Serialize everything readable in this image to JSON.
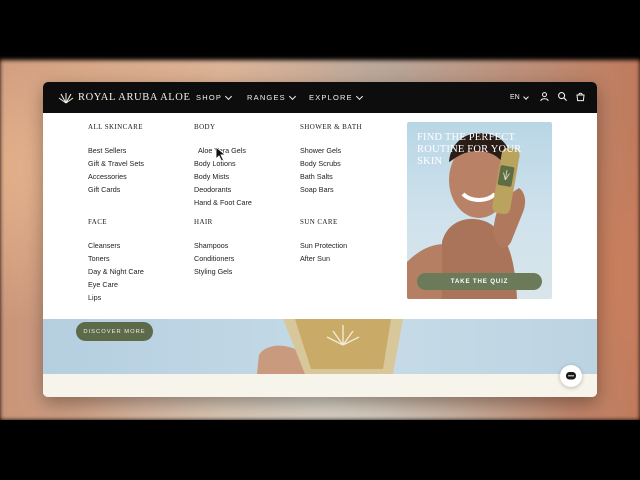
{
  "header": {
    "brand": "ROYAL ARUBA ALOE",
    "nav": [
      {
        "label": "SHOP"
      },
      {
        "label": "RANGES"
      },
      {
        "label": "EXPLORE"
      }
    ],
    "language": "EN"
  },
  "menu": {
    "columns": [
      {
        "heading": "ALL SKINCARE",
        "links": [
          "Best Sellers",
          "Gift & Travel Sets",
          "Accessories",
          "Gift Cards"
        ]
      },
      {
        "heading": "BODY",
        "links": [
          "Aloe Vera Gels",
          "Body Lotions",
          "Body Mists",
          "Deodorants",
          "Hand & Foot Care"
        ]
      },
      {
        "heading": "SHOWER & BATH",
        "links": [
          "Shower Gels",
          "Body Scrubs",
          "Bath Salts",
          "Soap Bars"
        ]
      },
      {
        "heading": "FACE",
        "links": [
          "Cleansers",
          "Toners",
          "Day & Night Care",
          "Eye Care",
          "Lips"
        ]
      },
      {
        "heading": "HAIR",
        "links": [
          "Shampoos",
          "Conditioners",
          "Styling Gels"
        ]
      },
      {
        "heading": "SUN CARE",
        "links": [
          "Sun Protection",
          "After Sun"
        ]
      }
    ]
  },
  "promo": {
    "title": "FIND THE PERFECT ROUTINE FOR YOUR SKIN",
    "button": "TAKE THE QUIZ"
  },
  "hero": {
    "button": "DISCOVER MORE"
  },
  "colors": {
    "nav_bg": "#0d0d0d",
    "accent_green": "#6b7a58",
    "promo_sky": "#b9d6e6"
  }
}
